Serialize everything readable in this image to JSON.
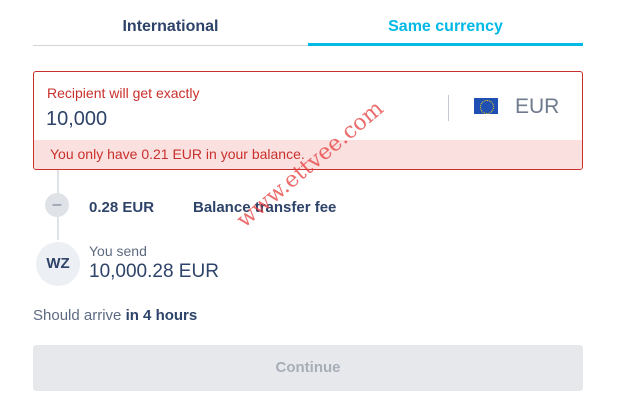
{
  "tabs": {
    "international": "International",
    "same_currency": "Same currency"
  },
  "recipient": {
    "label": "Recipient will get exactly",
    "amount": "10,000",
    "currency": "EUR",
    "currency_icon": "eu-flag-icon",
    "error": "You only have 0.21 EUR in your balance."
  },
  "fee": {
    "icon": "minus-icon",
    "symbol": "–",
    "amount": "0.28 EUR",
    "label": "Balance transfer fee"
  },
  "sender": {
    "initials": "WZ",
    "label": "You send",
    "amount": "10,000.28 EUR"
  },
  "arrival": {
    "prefix": "Should arrive",
    "time": "in 4 hours"
  },
  "continue_label": "Continue",
  "watermark": "www.ettvee.com",
  "colors": {
    "accent": "#00b9e6",
    "error": "#c9302c",
    "error_bg": "#fbe0e0",
    "text": "#2e4369"
  }
}
